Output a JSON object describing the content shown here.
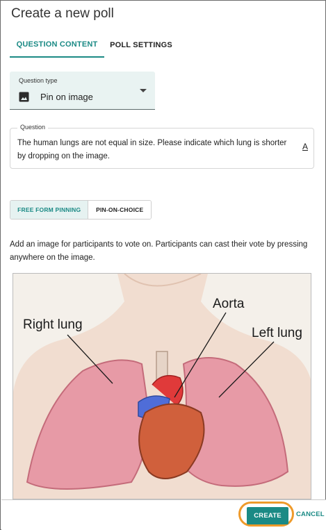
{
  "dialog": {
    "title": "Create a new poll"
  },
  "tabs": [
    {
      "label": "QUESTION CONTENT",
      "active": true
    },
    {
      "label": "POLL SETTINGS",
      "active": false
    }
  ],
  "question_type": {
    "label": "Question type",
    "value": "Pin on image",
    "icon": "image-icon"
  },
  "question": {
    "label": "Question",
    "text": "The human lungs are not equal in size. Please indicate which lung is shorter by dropping on the image.",
    "format_icon": "A"
  },
  "pin_mode": {
    "options": [
      {
        "label": "FREE FORM PINNING",
        "selected": true
      },
      {
        "label": "PIN-ON-CHOICE",
        "selected": false
      }
    ]
  },
  "instructions": "Add an image for participants to vote on. Participants can cast their vote by pressing anywhere on the image.",
  "image": {
    "labels": {
      "right_lung": "Right lung",
      "aorta": "Aorta",
      "left_lung": "Left lung"
    }
  },
  "footer": {
    "create_label": "CREATE",
    "cancel_label": "CANCEL"
  },
  "colors": {
    "accent": "#1b8a85",
    "highlight": "#ef9a2a"
  }
}
